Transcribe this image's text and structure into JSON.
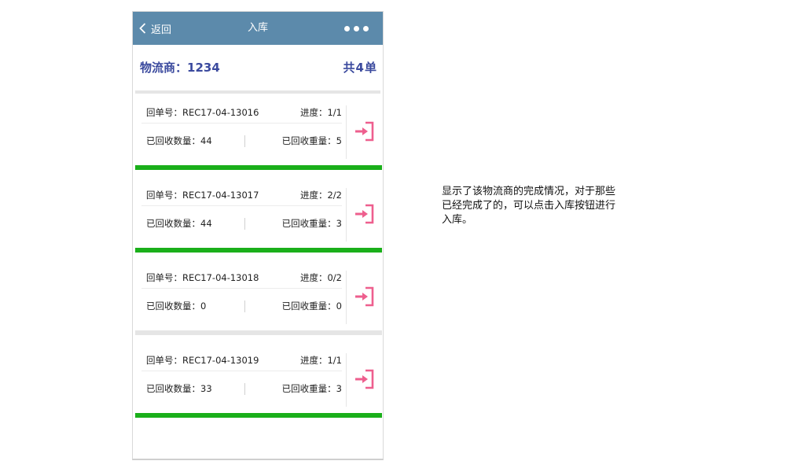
{
  "nav": {
    "back_label": "返回",
    "title": "入库"
  },
  "summary": {
    "vendor_label": "物流商：",
    "vendor_value": "1234",
    "total_prefix": "共",
    "total_count": "4",
    "total_suffix": "单"
  },
  "labels": {
    "order": "回单号：",
    "progress": "进度：",
    "count": "已回收数量：",
    "weight": "已回收重量："
  },
  "colors": {
    "nav_bg": "#5c8aab",
    "accent_text": "#3b4a9e",
    "complete_bar": "#1aaf1a",
    "incomplete_bar": "#e5e5e5",
    "icon_pink": "#ee5f8e"
  },
  "orders": [
    {
      "order_no": "REC17-04-13016",
      "progress": "1/1",
      "count": "44",
      "weight": "5",
      "complete": true,
      "icon": "login-icon"
    },
    {
      "order_no": "REC17-04-13017",
      "progress": "2/2",
      "count": "44",
      "weight": "3",
      "complete": true,
      "icon": "login-icon"
    },
    {
      "order_no": "REC17-04-13018",
      "progress": "0/2",
      "count": "0",
      "weight": "0",
      "complete": false,
      "icon": "login-icon"
    },
    {
      "order_no": "REC17-04-13019",
      "progress": "1/1",
      "count": "33",
      "weight": "3",
      "complete": true,
      "icon": "login-icon"
    }
  ],
  "annotation": {
    "line1": "显示了该物流商的完成情况，对于那些",
    "line2": "已经完成了的，可以点击入库按钮进行",
    "line3": "入库。"
  }
}
